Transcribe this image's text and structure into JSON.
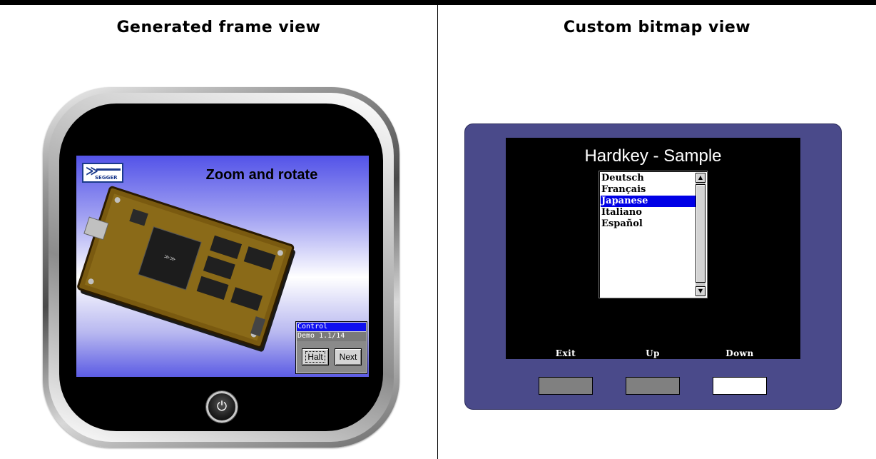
{
  "headings": {
    "left": "Generated frame view",
    "right": "Custom bitmap view"
  },
  "generated_frame": {
    "screen_title": "Zoom and rotate",
    "logo_text": "SEGGER",
    "control": {
      "caption": "Control",
      "info": "Demo 1.1/14",
      "buttons": [
        "Halt",
        "Next"
      ]
    },
    "power_icon": "power-icon"
  },
  "bitmap_view": {
    "title": "Hardkey - Sample",
    "listbox": {
      "items": [
        "Deutsch",
        "Français",
        "Japanese",
        "Italiano",
        "Español"
      ],
      "selected": "Japanese"
    },
    "hardkeys": [
      "Exit",
      "Up",
      "Down"
    ],
    "colors": {
      "bezel": "#4a4a8a",
      "selection": "#0000e6"
    }
  }
}
